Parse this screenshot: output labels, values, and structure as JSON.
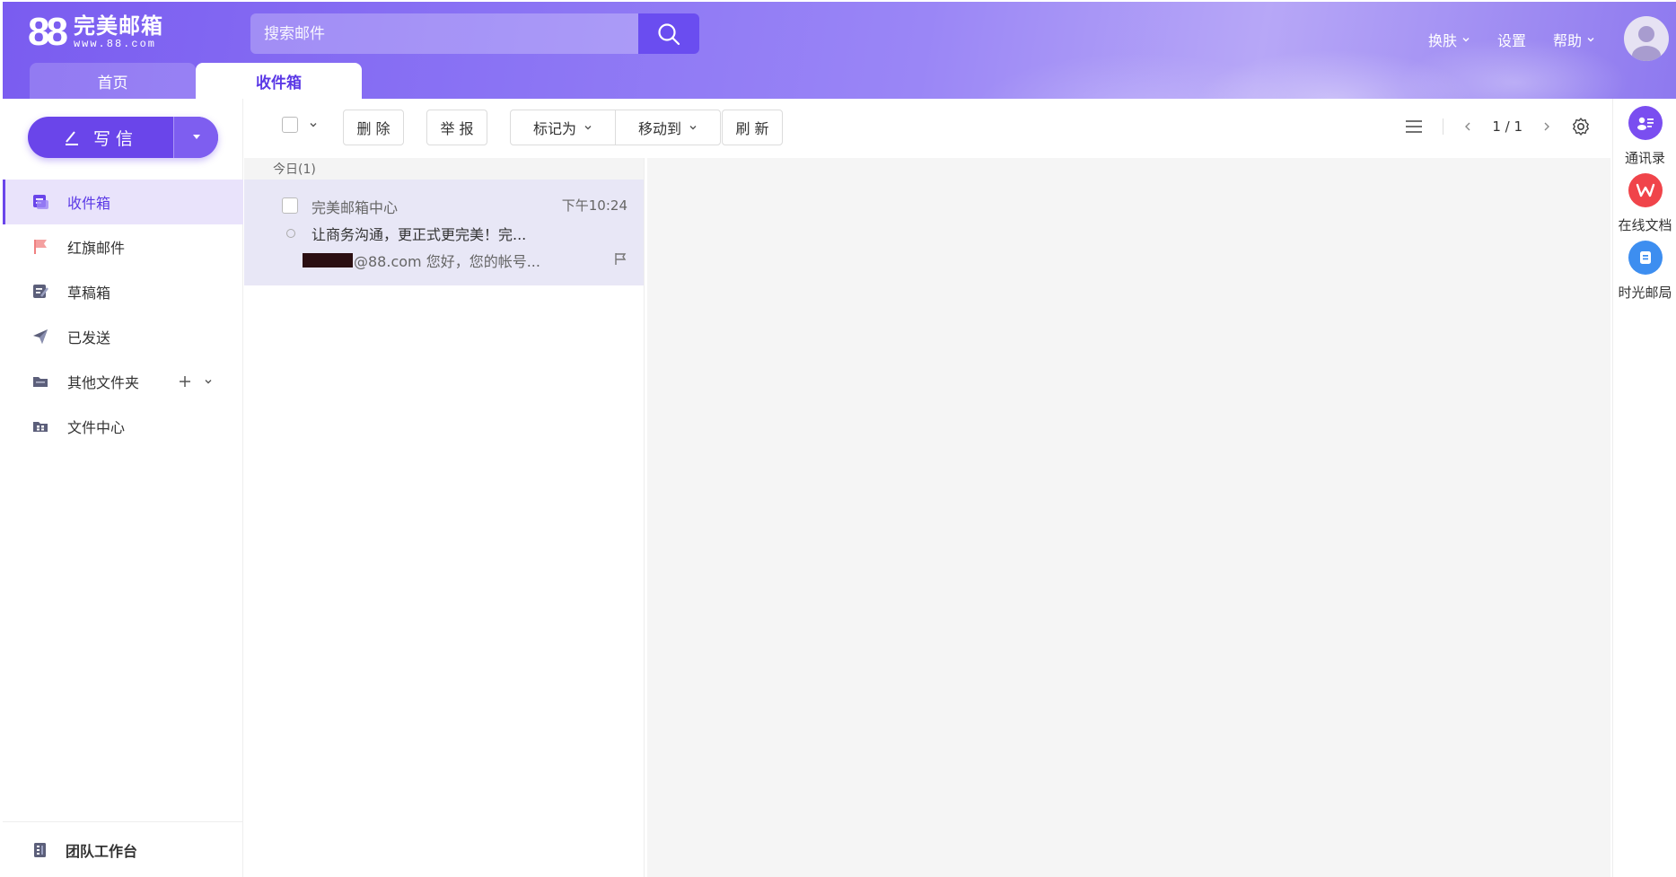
{
  "header": {
    "logo_number": "88",
    "logo_name": "完美邮箱",
    "logo_url": "www.88.com",
    "search_placeholder": "搜索邮件",
    "nav": [
      {
        "label": "换肤",
        "has_dropdown": true
      },
      {
        "label": "设置",
        "has_dropdown": false
      },
      {
        "label": "帮助",
        "has_dropdown": true
      }
    ],
    "tabs": [
      {
        "label": "首页",
        "active": false
      },
      {
        "label": "收件箱",
        "active": true
      }
    ]
  },
  "sidebar": {
    "compose_label": "写信",
    "folders": [
      {
        "label": "收件箱",
        "icon": "inbox-icon",
        "active": true
      },
      {
        "label": "红旗邮件",
        "icon": "red-flag-icon",
        "active": false
      },
      {
        "label": "草稿箱",
        "icon": "drafts-icon",
        "active": false
      },
      {
        "label": "已发送",
        "icon": "paper-plane-icon",
        "active": false
      },
      {
        "label": "其他文件夹",
        "icon": "folder-icon",
        "active": false,
        "has_actions": true
      },
      {
        "label": "文件中心",
        "icon": "file-center-icon",
        "active": false
      }
    ],
    "team_label": "团队工作台"
  },
  "toolbar": {
    "delete_label": "删 除",
    "report_label": "举 报",
    "mark_as_label": "标记为",
    "move_to_label": "移动到",
    "refresh_label": "刷 新",
    "page_indicator": "1 / 1"
  },
  "mail_list": {
    "group_label": "今日(1)",
    "items": [
      {
        "sender": "完美邮箱中心",
        "time": "下午10:24",
        "subject": "让商务沟通，更正式更完美！完...",
        "preview": "@88.com 您好，您的帐号..."
      }
    ]
  },
  "right_rail": {
    "apps": [
      {
        "label": "通讯录",
        "icon": "contacts-icon",
        "color": "#7a4ef0"
      },
      {
        "label": "在线文档",
        "icon": "wps-docs-icon",
        "color": "#f0444a"
      },
      {
        "label": "时光邮局",
        "icon": "time-post-icon",
        "color": "#3d8ef0"
      }
    ]
  },
  "colors": {
    "accent": "#6a45ea",
    "active_bg": "#e9e3fb",
    "selected_mail_bg": "#e8e7f6"
  }
}
